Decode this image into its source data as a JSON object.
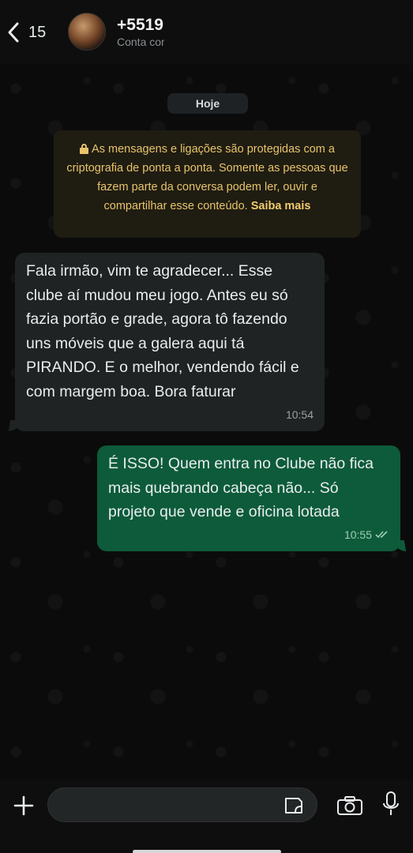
{
  "header": {
    "back_count": "15",
    "contact_name": "+5519",
    "contact_subtitle": "Conta comercial"
  },
  "chat": {
    "date_chip": "Hoje",
    "encryption_notice": "As mensagens e ligações são protegidas com a criptografia de ponta a ponta. Somente as pessoas que fazem parte da conversa podem ler, ouvir e compartilhar esse conteúdo.",
    "encryption_link": "Saiba mais",
    "messages": [
      {
        "direction": "incoming",
        "text": "Fala irmão, vim te agradecer... Esse clube aí mudou meu jogo. Antes eu só fazia portão e grade, agora tô fazendo uns móveis que a galera aqui tá PIRANDO. E o melhor, vendendo fácil e com margem boa. Bora faturar",
        "time": "10:54"
      },
      {
        "direction": "outgoing",
        "text": "É ISSO! Quem entra no Clube não fica mais quebrando cabeça não... Só projeto que vende e oficina lotada",
        "time": "10:55",
        "status": "read"
      }
    ]
  },
  "composer": {
    "input_value": "",
    "icons": [
      "plus-icon",
      "sticker-icon",
      "camera-icon",
      "mic-icon"
    ]
  },
  "colors": {
    "incoming_bubble": "#202324",
    "outgoing_bubble": "#0d5b3a",
    "notice_text": "#e7c46b"
  }
}
